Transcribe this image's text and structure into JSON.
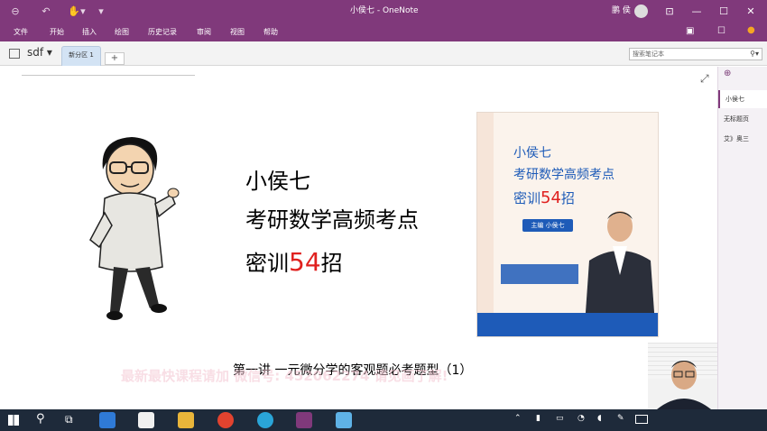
{
  "window": {
    "title": "小侯七 - OneNote",
    "user_name": "鹏 侯"
  },
  "menu": [
    "文件",
    "开始",
    "插入",
    "绘图",
    "历史记录",
    "审阅",
    "视图",
    "帮助"
  ],
  "notebook": {
    "name": "sdf",
    "section_tab": "新分区 1",
    "add_tab": "+",
    "search_placeholder": "搜索笔记本"
  },
  "pages": [
    "小侯七",
    "无标题页",
    "艾》奥三"
  ],
  "slide": {
    "line1": "小侯七",
    "line2": "考研数学高频考点",
    "line3_prefix": "密训",
    "line3_num": "54",
    "line3_suffix": "招",
    "caption": "第一讲   一元微分学的客观题必考题型（1）",
    "watermark": "最新最快课程请加 微信号: 452062274 请见画了解!"
  },
  "book": {
    "title_line1": "小侯七",
    "title_line2": "考研数学高频考点",
    "title_line3_prefix": "密训",
    "title_line3_num": "54",
    "title_line3_suffix": "招",
    "author_badge": "主编 小侯七"
  },
  "colors": {
    "titlebar": "#80397b",
    "accent_red": "#e0211f",
    "book_blue": "#1e5bb8",
    "taskbar": "#1e2a3a"
  }
}
